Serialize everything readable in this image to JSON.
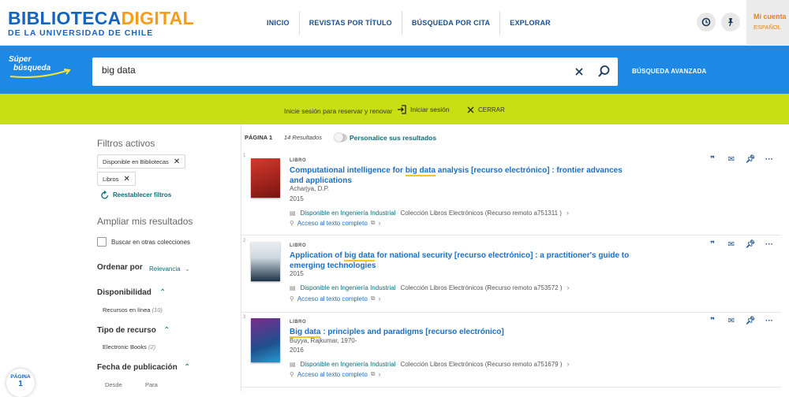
{
  "logo": {
    "part1": "BIBLIOTECA",
    "part2": "DIGITAL",
    "subtitle": "DE LA UNIVERSIDAD DE CHILE"
  },
  "nav": [
    "INICIO",
    "REVISTAS POR TÍTULO",
    "BÚSQUEDA POR CITA",
    "EXPLORAR"
  ],
  "account": {
    "label": "Mi cuenta",
    "language": "ESPAÑOL"
  },
  "search": {
    "brand_line1": "Súper",
    "brand_line2": "búsqueda",
    "query": "big data",
    "advanced": "BÚSQUEDA AVANZADA"
  },
  "login_banner": {
    "message": "Inicie sesión para reservar y renovar",
    "signin": "Iniciar sesión",
    "close": "CERRAR"
  },
  "sidebar": {
    "active_filters_title": "Filtros activos",
    "active_filters": [
      "Disponible en Bibliotecas",
      "Libros"
    ],
    "reset": "Reestablecer filtros",
    "expand_title": "Ampliar mis resultados",
    "other_collections": "Buscar en otras colecciones",
    "sort_label": "Ordenar por",
    "sort_value": "Relevancia",
    "availability_label": "Disponibilidad",
    "availability_items": [
      {
        "label": "Recursos en línea",
        "count": "(10)"
      }
    ],
    "resource_type_label": "Tipo de recurso",
    "resource_type_items": [
      {
        "label": "Electronic Books",
        "count": "(2)"
      }
    ],
    "pub_date_label": "Fecha de publicación",
    "date_from": "Desde",
    "date_to": "Para"
  },
  "pager": {
    "label": "PÁGINA",
    "number": "1"
  },
  "results_header": {
    "page": "PÁGINA 1",
    "count": "14 Resultados",
    "personalize": "Personalice sus resultados"
  },
  "records": [
    {
      "num": "1",
      "type": "LIBRO",
      "title_before": "Computational intelligence for ",
      "title_hl": "big data",
      "title_after": " analysis [recurso electrónico] : frontier advances and applications",
      "author": "Acharjya, D.P.",
      "year": "2015",
      "avail": "Disponible en Ingeniería Industrial",
      "avail_detail": "Colección Libros Electrónicos (Recurso remoto a751311 )",
      "online": "Acceso al texto completo"
    },
    {
      "num": "2",
      "type": "LIBRO",
      "title_before": "Application of ",
      "title_hl": "big data",
      "title_after": " for national security [recurso electrónico] : a practitioner's guide to emerging technologies",
      "author": "",
      "year": "2015",
      "avail": "Disponible en Ingeniería Industrial",
      "avail_detail": "Colección Libros Electrónicos (Recurso remoto a753572 )",
      "online": "Acceso al texto completo"
    },
    {
      "num": "3",
      "type": "LIBRO",
      "title_before": "",
      "title_hl": "Big data",
      "title_after": " : principles and paradigms [recurso electrónico]",
      "author": "Buyya, Rajkumar, 1970-",
      "year": "2016",
      "avail": "Disponible en Ingeniería Industrial",
      "avail_detail": "Colección Libros Electrónicos (Recurso remoto a751679 )",
      "online": "Acceso al texto completo"
    }
  ],
  "colors": {
    "brand_blue": "#1e88e5",
    "banner_green": "#c8df16",
    "accent_orange": "#f59c1a",
    "link_blue": "#1a6fc4",
    "teal": "#0b6e7a"
  },
  "icons": [
    "history-icon",
    "pin-icon",
    "clear-icon",
    "search-icon",
    "signin-icon",
    "close-icon",
    "cite-icon",
    "email-icon",
    "pin-icon",
    "more-icon",
    "refresh-icon"
  ]
}
